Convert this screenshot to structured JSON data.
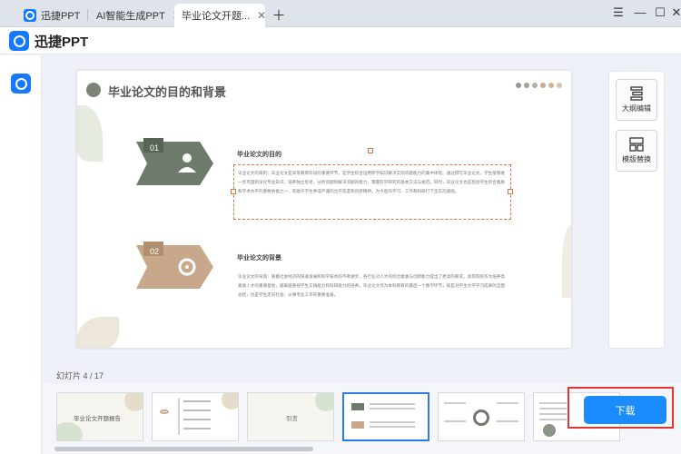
{
  "tabs": [
    {
      "label": "迅捷PPT",
      "has_close": false,
      "active": false
    },
    {
      "label": "AI智能生成PPT",
      "has_close": true,
      "active": false
    },
    {
      "label": "毕业论文开题...",
      "has_close": true,
      "active": true
    }
  ],
  "tabbar": {
    "add_icon": "＋",
    "menu_icon": "☰",
    "minimize_icon": "—",
    "maximize_icon": "☐",
    "close_icon": "✕"
  },
  "brand": {
    "name": "迅捷PPT"
  },
  "slide": {
    "title": "毕业论文的目的和背景",
    "sections": [
      {
        "number": "01",
        "heading": "毕业论文的目的",
        "body": "毕业论文的目的：毕业论文是高等教育阶段的重要环节，是学生综合运用所学知识解决实际问题能力的集中体现。通过撰写毕业论文，学生能够进一步巩固和深化专业知识，培养独立思考、分析问题和解决问题的能力，掌握科学研究的基本方法与规范。同时，毕业论文也是检验学生综合素质和学术水平的重要依据之一，有助于学生养成严谨的治学态度和创新精神，为今后的学习、工作和科研打下坚实的基础。"
      },
      {
        "number": "02",
        "heading": "毕业论文的背景",
        "body": "毕业论文的背景：随着社会经济的快速发展和科学技术的不断进步，各行业对人才的综合素质与创新能力提出了更高的要求。高等院校作为培养高素质人才的重要基地，越来越重视学生实践能力和科研能力的培养。毕业论文作为本科教育的最后一个教学环节，既是对学生大学学习成果的全面总结，也是学生走向社会、从事专业工作的重要准备。"
      }
    ]
  },
  "tools": [
    {
      "label": "大纲编辑",
      "icon": "outline-icon"
    },
    {
      "label": "模版替换",
      "icon": "template-icon"
    }
  ],
  "filmstrip": {
    "counter": "幻灯片 4 / 17",
    "thumbs": [
      {
        "text": "毕业论文开题报告"
      },
      {
        "text": ""
      },
      {
        "text": "引言"
      },
      {
        "text": ""
      },
      {
        "text": ""
      },
      {
        "text": ""
      }
    ]
  },
  "download": {
    "label": "下载"
  },
  "colors": {
    "accent": "#1a8cff",
    "highlight": "#e5362f",
    "slide_green": "#6e7a6c",
    "slide_tan": "#c7a88a"
  }
}
